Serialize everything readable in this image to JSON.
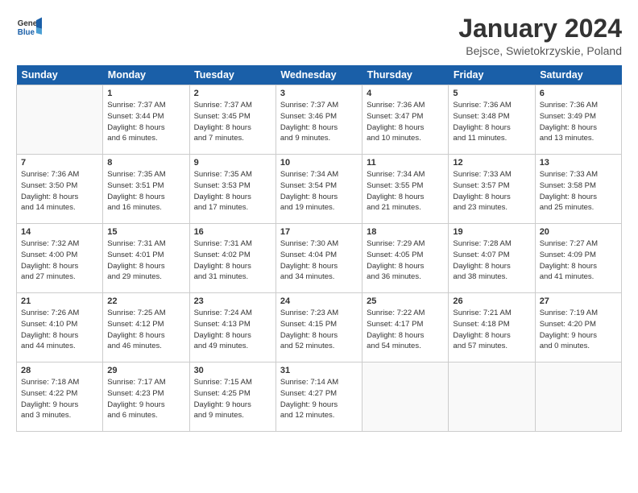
{
  "header": {
    "logo_line1": "General",
    "logo_line2": "Blue",
    "month_title": "January 2024",
    "location": "Bejsce, Swietokrzyskie, Poland"
  },
  "days_of_week": [
    "Sunday",
    "Monday",
    "Tuesday",
    "Wednesday",
    "Thursday",
    "Friday",
    "Saturday"
  ],
  "weeks": [
    [
      {
        "day": "",
        "info": ""
      },
      {
        "day": "1",
        "info": "Sunrise: 7:37 AM\nSunset: 3:44 PM\nDaylight: 8 hours\nand 6 minutes."
      },
      {
        "day": "2",
        "info": "Sunrise: 7:37 AM\nSunset: 3:45 PM\nDaylight: 8 hours\nand 7 minutes."
      },
      {
        "day": "3",
        "info": "Sunrise: 7:37 AM\nSunset: 3:46 PM\nDaylight: 8 hours\nand 9 minutes."
      },
      {
        "day": "4",
        "info": "Sunrise: 7:36 AM\nSunset: 3:47 PM\nDaylight: 8 hours\nand 10 minutes."
      },
      {
        "day": "5",
        "info": "Sunrise: 7:36 AM\nSunset: 3:48 PM\nDaylight: 8 hours\nand 11 minutes."
      },
      {
        "day": "6",
        "info": "Sunrise: 7:36 AM\nSunset: 3:49 PM\nDaylight: 8 hours\nand 13 minutes."
      }
    ],
    [
      {
        "day": "7",
        "info": "Sunrise: 7:36 AM\nSunset: 3:50 PM\nDaylight: 8 hours\nand 14 minutes."
      },
      {
        "day": "8",
        "info": "Sunrise: 7:35 AM\nSunset: 3:51 PM\nDaylight: 8 hours\nand 16 minutes."
      },
      {
        "day": "9",
        "info": "Sunrise: 7:35 AM\nSunset: 3:53 PM\nDaylight: 8 hours\nand 17 minutes."
      },
      {
        "day": "10",
        "info": "Sunrise: 7:34 AM\nSunset: 3:54 PM\nDaylight: 8 hours\nand 19 minutes."
      },
      {
        "day": "11",
        "info": "Sunrise: 7:34 AM\nSunset: 3:55 PM\nDaylight: 8 hours\nand 21 minutes."
      },
      {
        "day": "12",
        "info": "Sunrise: 7:33 AM\nSunset: 3:57 PM\nDaylight: 8 hours\nand 23 minutes."
      },
      {
        "day": "13",
        "info": "Sunrise: 7:33 AM\nSunset: 3:58 PM\nDaylight: 8 hours\nand 25 minutes."
      }
    ],
    [
      {
        "day": "14",
        "info": "Sunrise: 7:32 AM\nSunset: 4:00 PM\nDaylight: 8 hours\nand 27 minutes."
      },
      {
        "day": "15",
        "info": "Sunrise: 7:31 AM\nSunset: 4:01 PM\nDaylight: 8 hours\nand 29 minutes."
      },
      {
        "day": "16",
        "info": "Sunrise: 7:31 AM\nSunset: 4:02 PM\nDaylight: 8 hours\nand 31 minutes."
      },
      {
        "day": "17",
        "info": "Sunrise: 7:30 AM\nSunset: 4:04 PM\nDaylight: 8 hours\nand 34 minutes."
      },
      {
        "day": "18",
        "info": "Sunrise: 7:29 AM\nSunset: 4:05 PM\nDaylight: 8 hours\nand 36 minutes."
      },
      {
        "day": "19",
        "info": "Sunrise: 7:28 AM\nSunset: 4:07 PM\nDaylight: 8 hours\nand 38 minutes."
      },
      {
        "day": "20",
        "info": "Sunrise: 7:27 AM\nSunset: 4:09 PM\nDaylight: 8 hours\nand 41 minutes."
      }
    ],
    [
      {
        "day": "21",
        "info": "Sunrise: 7:26 AM\nSunset: 4:10 PM\nDaylight: 8 hours\nand 44 minutes."
      },
      {
        "day": "22",
        "info": "Sunrise: 7:25 AM\nSunset: 4:12 PM\nDaylight: 8 hours\nand 46 minutes."
      },
      {
        "day": "23",
        "info": "Sunrise: 7:24 AM\nSunset: 4:13 PM\nDaylight: 8 hours\nand 49 minutes."
      },
      {
        "day": "24",
        "info": "Sunrise: 7:23 AM\nSunset: 4:15 PM\nDaylight: 8 hours\nand 52 minutes."
      },
      {
        "day": "25",
        "info": "Sunrise: 7:22 AM\nSunset: 4:17 PM\nDaylight: 8 hours\nand 54 minutes."
      },
      {
        "day": "26",
        "info": "Sunrise: 7:21 AM\nSunset: 4:18 PM\nDaylight: 8 hours\nand 57 minutes."
      },
      {
        "day": "27",
        "info": "Sunrise: 7:19 AM\nSunset: 4:20 PM\nDaylight: 9 hours\nand 0 minutes."
      }
    ],
    [
      {
        "day": "28",
        "info": "Sunrise: 7:18 AM\nSunset: 4:22 PM\nDaylight: 9 hours\nand 3 minutes."
      },
      {
        "day": "29",
        "info": "Sunrise: 7:17 AM\nSunset: 4:23 PM\nDaylight: 9 hours\nand 6 minutes."
      },
      {
        "day": "30",
        "info": "Sunrise: 7:15 AM\nSunset: 4:25 PM\nDaylight: 9 hours\nand 9 minutes."
      },
      {
        "day": "31",
        "info": "Sunrise: 7:14 AM\nSunset: 4:27 PM\nDaylight: 9 hours\nand 12 minutes."
      },
      {
        "day": "",
        "info": ""
      },
      {
        "day": "",
        "info": ""
      },
      {
        "day": "",
        "info": ""
      }
    ]
  ]
}
